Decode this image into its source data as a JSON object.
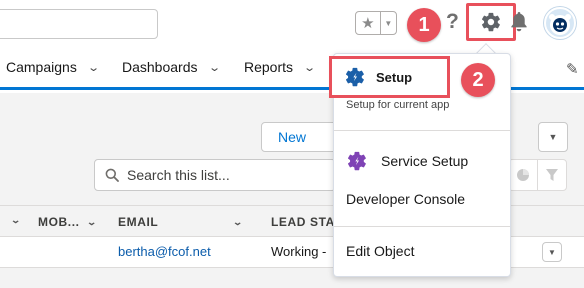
{
  "header": {
    "favorites_star": "★",
    "favorites_menu": "▼",
    "help": "?"
  },
  "nav": {
    "items": [
      {
        "label": "Campaigns"
      },
      {
        "label": "Dashboards"
      },
      {
        "label": "Reports"
      }
    ],
    "chevron": "⌄",
    "edit_icon": "✎"
  },
  "list": {
    "new_label": "New",
    "search_placeholder": "Search this list...",
    "actions_caret": "▼"
  },
  "table": {
    "columns": [
      {
        "label": "MOB...",
        "chevron": "⌄"
      },
      {
        "label": "EMAIL",
        "chevron": "⌄"
      },
      {
        "label": "LEAD STA",
        "chevron": ""
      }
    ],
    "leading_chevron": "⌄",
    "rows": [
      {
        "email": "bertha@fcof.net",
        "status": "Working -"
      }
    ],
    "row_menu_caret": "▼"
  },
  "dropdown": {
    "setup_label": "Setup",
    "setup_current": "Setup for current app",
    "service_setup_label": "Service Setup",
    "developer_console_label": "Developer Console",
    "edit_object_label": "Edit Object"
  },
  "annotations": {
    "step1": "1",
    "step2": "2"
  },
  "colors": {
    "callout_red": "#e8505b",
    "brand_blue": "#0176d3",
    "setup_gear_blue": "#1b5fa8",
    "service_gear_purple": "#7f43b5",
    "link_blue": "#0b5cab"
  }
}
